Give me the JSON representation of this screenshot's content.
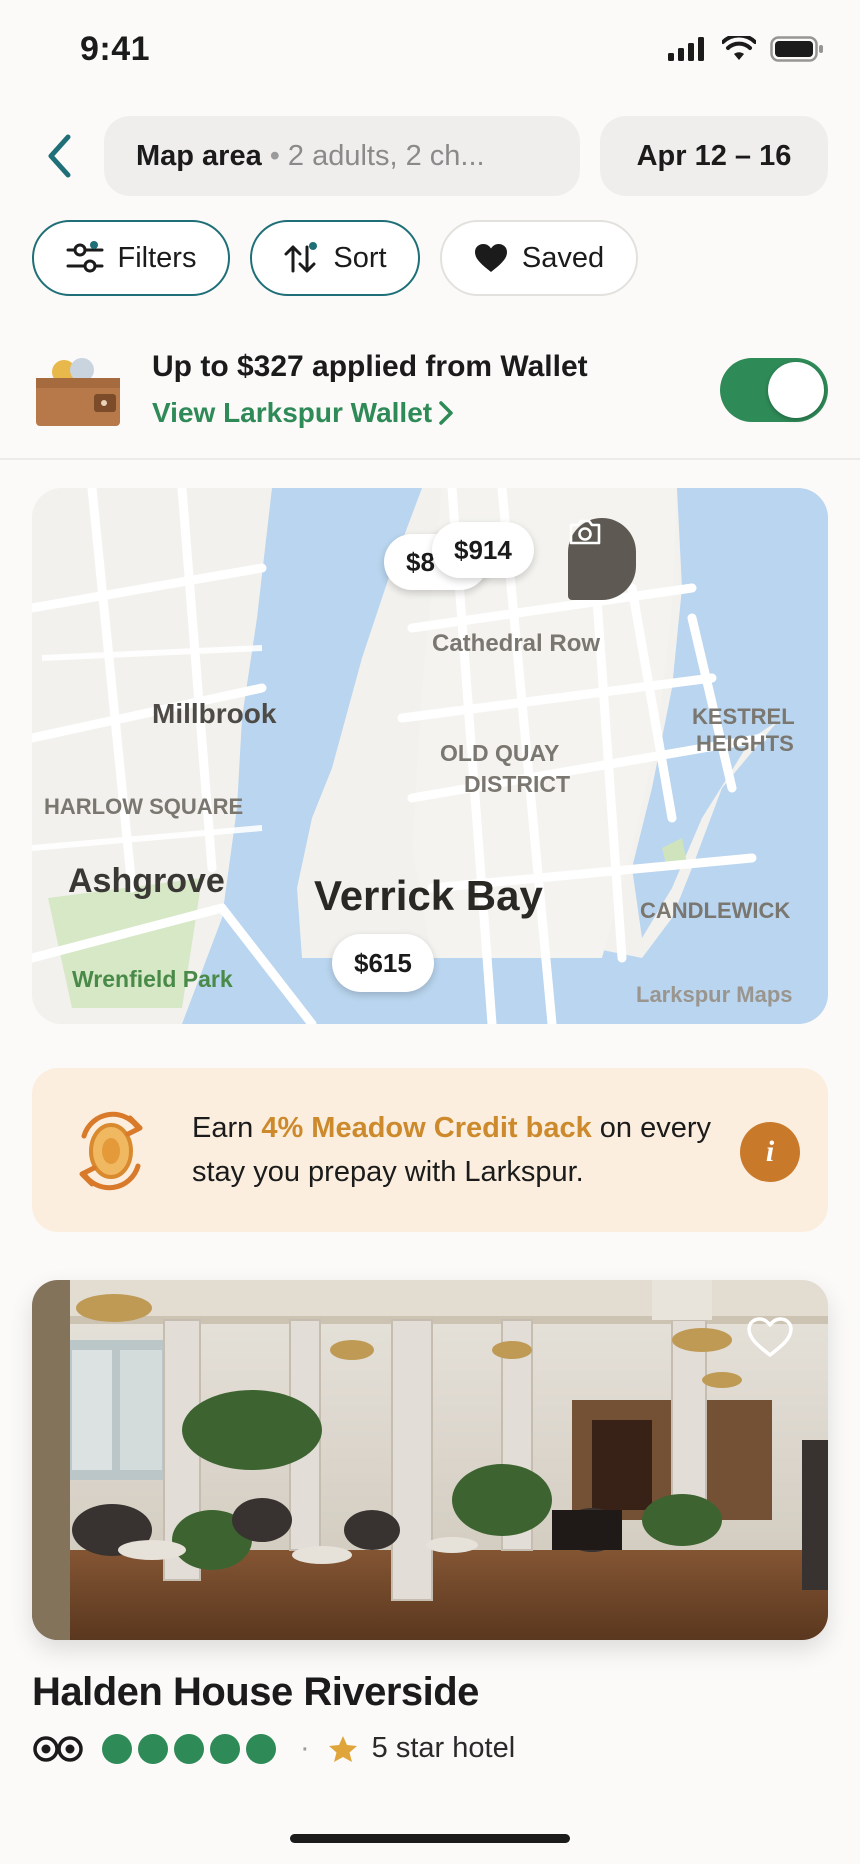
{
  "status_bar": {
    "time": "9:41"
  },
  "search": {
    "location": "Map area",
    "separator": "•",
    "guests": "2 adults, 2 ch...",
    "dates": "Apr 12 – 16"
  },
  "chips": {
    "filters": "Filters",
    "sort": "Sort",
    "saved": "Saved"
  },
  "wallet": {
    "title": "Up to $327 applied from Wallet",
    "link": "View Larkspur Wallet",
    "toggle_on": true
  },
  "map": {
    "labels": {
      "cathedral_row": "Cathedral Row",
      "millbrook": "Millbrook",
      "old_quay_1": "OLD QUAY",
      "old_quay_2": "DISTRICT",
      "kestrel_1": "KESTREL",
      "kestrel_2": "HEIGHTS",
      "harlow": "HARLOW SQUARE",
      "ashgrove": "Ashgrove",
      "verrick": "Verrick Bay",
      "candlewick": "CANDLEWICK",
      "wrenfield": "Wrenfield Park",
      "attribution": "Larkspur Maps"
    },
    "prices": {
      "pin_partial": "$8",
      "pin_914": "$914",
      "pin_615": "$615"
    }
  },
  "promo": {
    "earn": "Earn",
    "highlight": "4% Meadow Credit back",
    "rest": "on every stay you prepay with Larkspur.",
    "info": "i"
  },
  "hotel": {
    "name": "Halden House Riverside",
    "rating_dots": 5,
    "separator": "·",
    "class": "5 star hotel"
  },
  "colors": {
    "accent_teal": "#1f6f78",
    "wallet_green": "#2e8a57",
    "promo_bg": "#fbeede",
    "promo_highlight": "#cc8a2c"
  }
}
